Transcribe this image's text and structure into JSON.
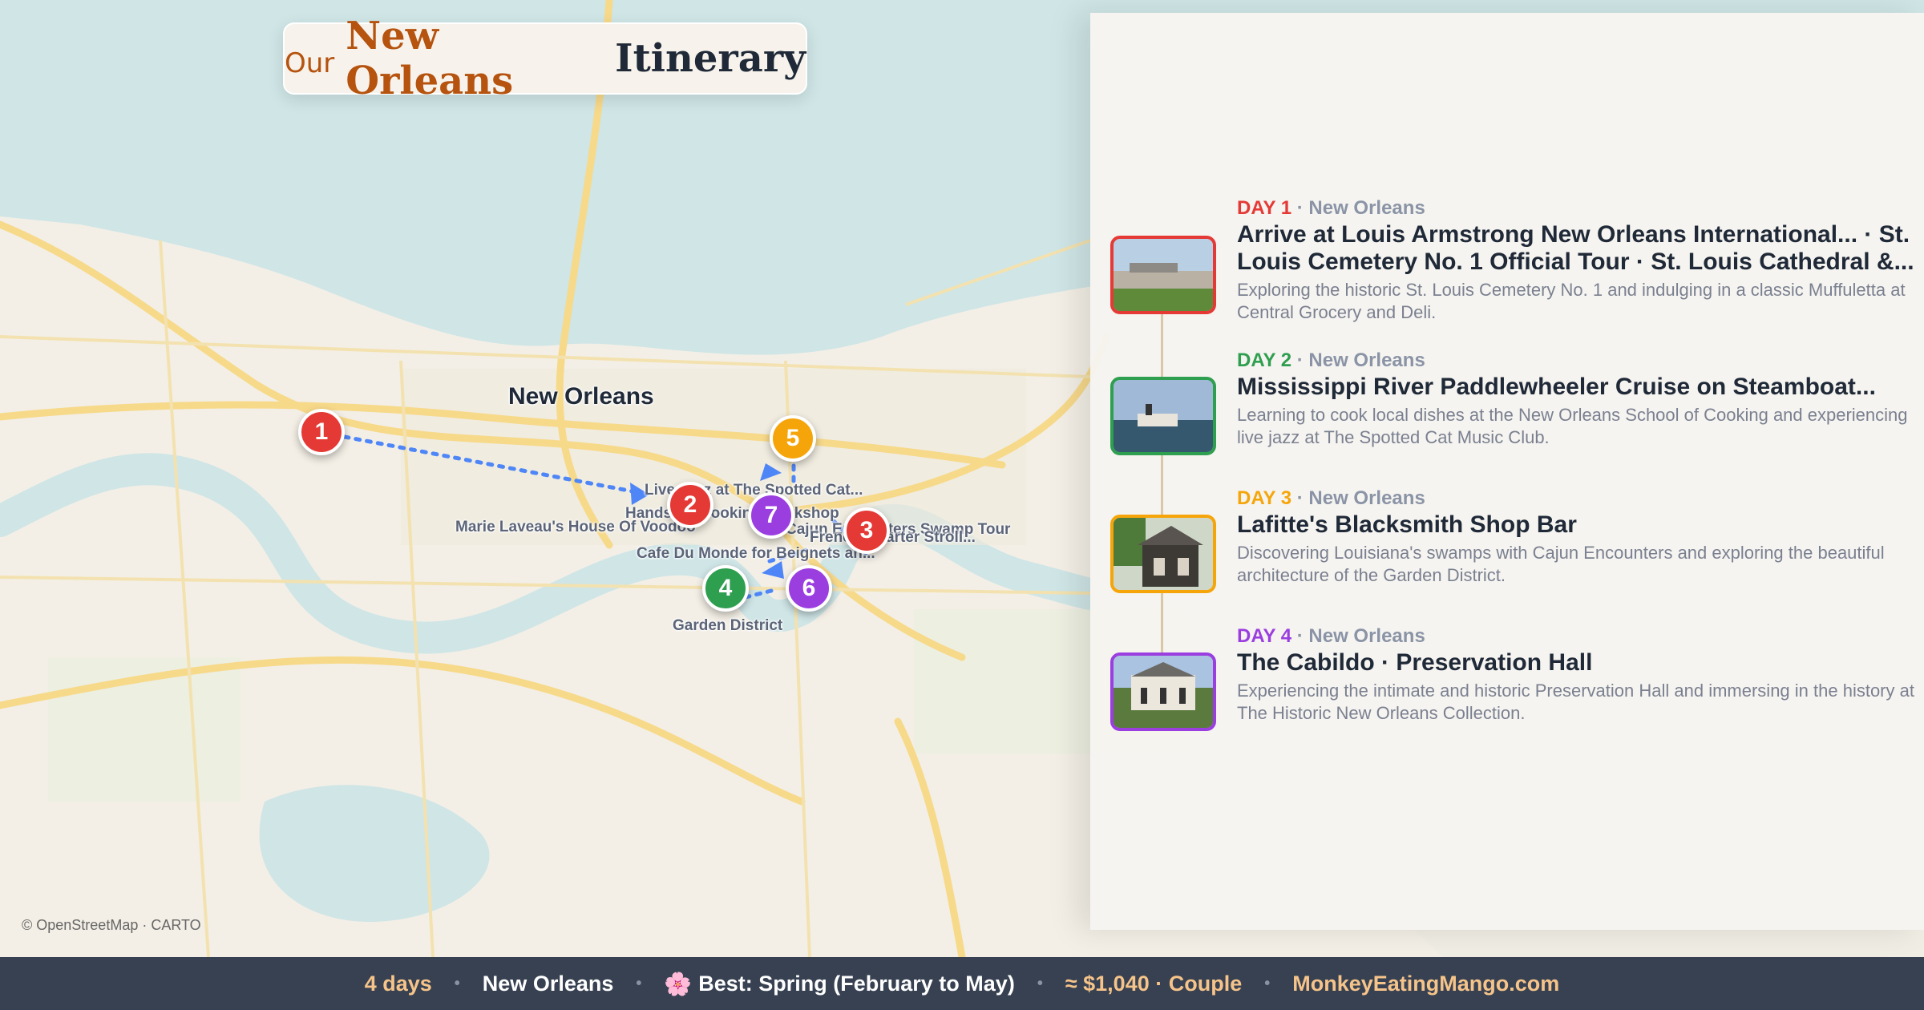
{
  "title": {
    "our": "Our",
    "city": "New Orleans",
    "rest": "Itinerary"
  },
  "map": {
    "city_label": "New Orleans",
    "attribution": "© OpenStreetMap · CARTO",
    "place_labels": {
      "spotted_cat": "Live Jazz at The Spotted Cat...",
      "cooking_workshop": "Hands-on Cooking Workshop",
      "marie_laveau": "Marie Laveau's House Of Voodoo",
      "swamp_tour": "Cajun Encounters Swamp Tour",
      "french_quarter_stroll": "French Quarter Stroll...",
      "cafe_du_monde": "Cafe Du Monde for Beignets an...",
      "garden_district": "Garden District"
    },
    "markers": [
      {
        "label": "1",
        "color": "#e53935"
      },
      {
        "label": "2",
        "color": "#e53935"
      },
      {
        "label": "3",
        "color": "#e53935"
      },
      {
        "label": "4",
        "color": "#2e9e4f"
      },
      {
        "label": "5",
        "color": "#f5a50a"
      },
      {
        "label": "6",
        "color": "#9b3ee0"
      },
      {
        "label": "7",
        "color": "#9b3ee0"
      }
    ],
    "route_color": "#4f86f7"
  },
  "days": [
    {
      "day": "DAY 1",
      "city": "· New Orleans",
      "color": "#e53935",
      "title": "Arrive at Louis Armstrong New Orleans International... · St. Louis Cemetery No. 1 Official Tour · St. Louis Cathedral &...",
      "desc": "Exploring the historic St. Louis Cemetery No. 1 and indulging in a classic Muffuletta at Central Grocery and Deli.",
      "thumb": "airport-photo"
    },
    {
      "day": "DAY 2",
      "city": "· New Orleans",
      "color": "#2e9e4f",
      "title": "Mississippi River Paddlewheeler Cruise on Steamboat...",
      "desc": "Learning to cook local dishes at the New Orleans School of Cooking and experiencing live jazz at The Spotted Cat Music Club.",
      "thumb": "steamboat-photo"
    },
    {
      "day": "DAY 3",
      "city": "· New Orleans",
      "color": "#f5a50a",
      "title": "Lafitte's Blacksmith Shop Bar",
      "desc": "Discovering Louisiana's swamps with Cajun Encounters and exploring the beautiful architecture of the Garden District.",
      "thumb": "blacksmith-shop-photo"
    },
    {
      "day": "DAY 4",
      "city": "· New Orleans",
      "color": "#9b3ee0",
      "title": "The Cabildo · Preservation Hall",
      "desc": "Experiencing the intimate and historic Preservation Hall and immersing in the history at The Historic New Orleans Collection.",
      "thumb": "cabildo-photo"
    }
  ],
  "footer": {
    "duration": "4 days",
    "city": "New Orleans",
    "season_icon": "cherry-blossom-icon",
    "season": "Best: Spring (February to May)",
    "budget": "≈ $1,040 · Couple",
    "site": "MonkeyEatingMango.com",
    "accent_color": "#f6c48a"
  }
}
